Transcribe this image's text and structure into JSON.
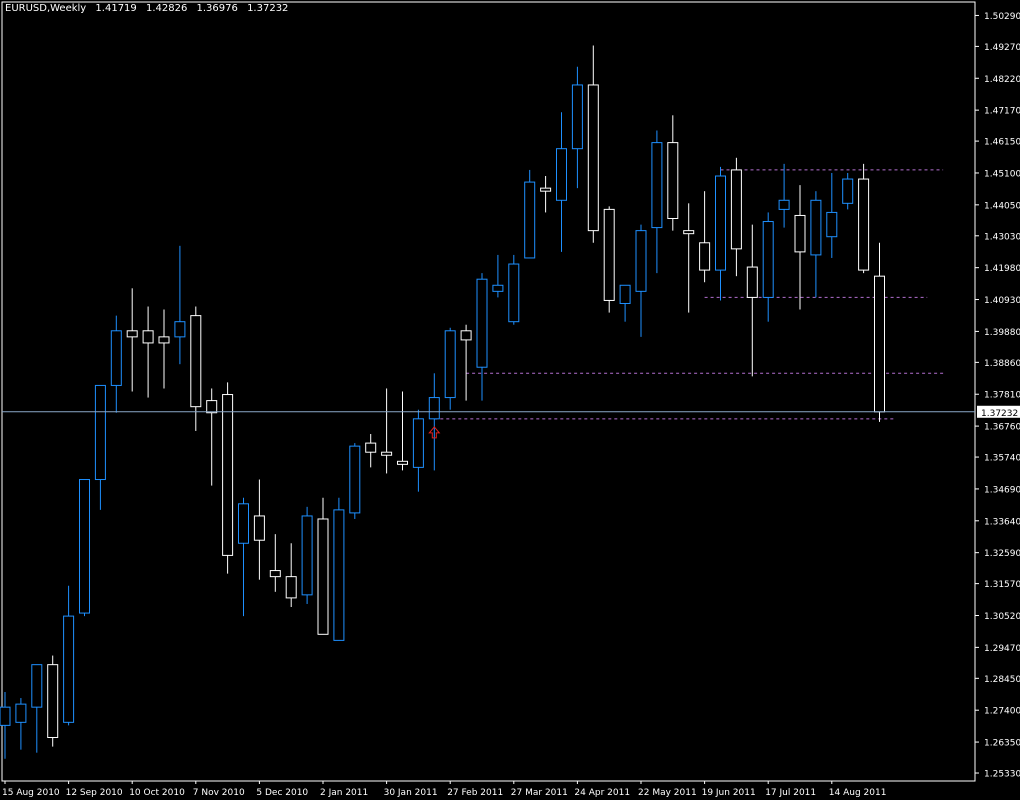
{
  "header": {
    "symbol": "EURUSD,Weekly",
    "open": "1.41719",
    "high": "1.42826",
    "low": "1.36976",
    "close": "1.37232"
  },
  "colors": {
    "background": "#000000",
    "bull": "#1e90ff",
    "bear": "#ffffff",
    "wick_bull": "#1e90ff",
    "wick_bear": "#ffffff",
    "grid_axis": "#ffffff",
    "price_line": "#8aa8c8",
    "level_line": "#b36fcf",
    "arrow": "#e02020"
  },
  "chart_data": {
    "type": "candlestick",
    "price_axis": {
      "ylim": [
        1.251,
        1.507
      ],
      "ticks": [
        "1.50290",
        "1.49270",
        "1.48220",
        "1.47170",
        "1.46150",
        "1.45100",
        "1.44050",
        "1.43030",
        "1.41980",
        "1.40930",
        "1.39880",
        "1.38860",
        "1.37810",
        "1.36760",
        "1.35740",
        "1.34690",
        "1.33640",
        "1.32590",
        "1.31570",
        "1.30520",
        "1.29470",
        "1.28450",
        "1.27400",
        "1.26350",
        "1.25330"
      ]
    },
    "time_axis": {
      "labels": [
        {
          "text": "15 Aug 2010",
          "index": 0
        },
        {
          "text": "12 Sep 2010",
          "index": 4
        },
        {
          "text": "10 Oct 2010",
          "index": 8
        },
        {
          "text": "7 Nov 2010",
          "index": 12
        },
        {
          "text": "5 Dec 2010",
          "index": 16
        },
        {
          "text": "2 Jan 2011",
          "index": 20
        },
        {
          "text": "30 Jan 2011",
          "index": 24
        },
        {
          "text": "27 Feb 2011",
          "index": 28
        },
        {
          "text": "27 Mar 2011",
          "index": 32
        },
        {
          "text": "24 Apr 2011",
          "index": 36
        },
        {
          "text": "22 May 2011",
          "index": 40
        },
        {
          "text": "19 Jun 2011",
          "index": 44
        },
        {
          "text": "17 Jul 2011",
          "index": 48
        },
        {
          "text": "14 Aug 2011",
          "index": 52
        }
      ]
    },
    "current_price": "1.37232",
    "candles": [
      {
        "o": 1.269,
        "h": 1.28,
        "l": 1.258,
        "c": 1.275
      },
      {
        "o": 1.27,
        "h": 1.278,
        "l": 1.261,
        "c": 1.276
      },
      {
        "o": 1.275,
        "h": 1.289,
        "l": 1.26,
        "c": 1.289
      },
      {
        "o": 1.289,
        "h": 1.292,
        "l": 1.262,
        "c": 1.265
      },
      {
        "o": 1.27,
        "h": 1.315,
        "l": 1.269,
        "c": 1.305
      },
      {
        "o": 1.306,
        "h": 1.319,
        "l": 1.305,
        "c": 1.35
      },
      {
        "o": 1.35,
        "h": 1.379,
        "l": 1.34,
        "c": 1.381
      },
      {
        "o": 1.381,
        "h": 1.404,
        "l": 1.372,
        "c": 1.399
      },
      {
        "o": 1.399,
        "h": 1.413,
        "l": 1.379,
        "c": 1.397
      },
      {
        "o": 1.399,
        "h": 1.407,
        "l": 1.377,
        "c": 1.395
      },
      {
        "o": 1.397,
        "h": 1.406,
        "l": 1.38,
        "c": 1.395
      },
      {
        "o": 1.397,
        "h": 1.427,
        "l": 1.388,
        "c": 1.402
      },
      {
        "o": 1.404,
        "h": 1.407,
        "l": 1.366,
        "c": 1.374
      },
      {
        "o": 1.376,
        "h": 1.38,
        "l": 1.348,
        "c": 1.372
      },
      {
        "o": 1.378,
        "h": 1.382,
        "l": 1.319,
        "c": 1.325
      },
      {
        "o": 1.329,
        "h": 1.344,
        "l": 1.305,
        "c": 1.342
      },
      {
        "o": 1.338,
        "h": 1.35,
        "l": 1.317,
        "c": 1.33
      },
      {
        "o": 1.32,
        "h": 1.332,
        "l": 1.313,
        "c": 1.318
      },
      {
        "o": 1.318,
        "h": 1.329,
        "l": 1.308,
        "c": 1.311
      },
      {
        "o": 1.312,
        "h": 1.341,
        "l": 1.309,
        "c": 1.338
      },
      {
        "o": 1.337,
        "h": 1.344,
        "l": 1.299,
        "c": 1.299
      },
      {
        "o": 1.297,
        "h": 1.344,
        "l": 1.297,
        "c": 1.34
      },
      {
        "o": 1.339,
        "h": 1.362,
        "l": 1.337,
        "c": 1.361
      },
      {
        "o": 1.362,
        "h": 1.365,
        "l": 1.354,
        "c": 1.359
      },
      {
        "o": 1.359,
        "h": 1.38,
        "l": 1.352,
        "c": 1.358
      },
      {
        "o": 1.356,
        "h": 1.379,
        "l": 1.353,
        "c": 1.355
      },
      {
        "o": 1.354,
        "h": 1.373,
        "l": 1.346,
        "c": 1.37
      },
      {
        "o": 1.37,
        "h": 1.385,
        "l": 1.353,
        "c": 1.377
      },
      {
        "o": 1.377,
        "h": 1.4,
        "l": 1.373,
        "c": 1.399
      },
      {
        "o": 1.399,
        "h": 1.401,
        "l": 1.376,
        "c": 1.396
      },
      {
        "o": 1.387,
        "h": 1.418,
        "l": 1.376,
        "c": 1.416
      },
      {
        "o": 1.412,
        "h": 1.424,
        "l": 1.41,
        "c": 1.414
      },
      {
        "o": 1.402,
        "h": 1.424,
        "l": 1.401,
        "c": 1.421
      },
      {
        "o": 1.423,
        "h": 1.452,
        "l": 1.423,
        "c": 1.448
      },
      {
        "o": 1.446,
        "h": 1.45,
        "l": 1.438,
        "c": 1.445
      },
      {
        "o": 1.442,
        "h": 1.471,
        "l": 1.425,
        "c": 1.459
      },
      {
        "o": 1.459,
        "h": 1.486,
        "l": 1.446,
        "c": 1.48
      },
      {
        "o": 1.48,
        "h": 1.493,
        "l": 1.428,
        "c": 1.432
      },
      {
        "o": 1.439,
        "h": 1.44,
        "l": 1.405,
        "c": 1.409
      },
      {
        "o": 1.408,
        "h": 1.414,
        "l": 1.402,
        "c": 1.414
      },
      {
        "o": 1.412,
        "h": 1.434,
        "l": 1.397,
        "c": 1.432
      },
      {
        "o": 1.433,
        "h": 1.465,
        "l": 1.418,
        "c": 1.461
      },
      {
        "o": 1.461,
        "h": 1.47,
        "l": 1.432,
        "c": 1.436
      },
      {
        "o": 1.432,
        "h": 1.441,
        "l": 1.405,
        "c": 1.431
      },
      {
        "o": 1.428,
        "h": 1.445,
        "l": 1.415,
        "c": 1.419
      },
      {
        "o": 1.419,
        "h": 1.453,
        "l": 1.409,
        "c": 1.45
      },
      {
        "o": 1.452,
        "h": 1.456,
        "l": 1.417,
        "c": 1.426
      },
      {
        "o": 1.42,
        "h": 1.434,
        "l": 1.384,
        "c": 1.41
      },
      {
        "o": 1.41,
        "h": 1.438,
        "l": 1.402,
        "c": 1.435
      },
      {
        "o": 1.439,
        "h": 1.454,
        "l": 1.433,
        "c": 1.442
      },
      {
        "o": 1.437,
        "h": 1.447,
        "l": 1.406,
        "c": 1.425
      },
      {
        "o": 1.424,
        "h": 1.445,
        "l": 1.41,
        "c": 1.442
      },
      {
        "o": 1.43,
        "h": 1.451,
        "l": 1.423,
        "c": 1.438
      },
      {
        "o": 1.441,
        "h": 1.451,
        "l": 1.439,
        "c": 1.449
      },
      {
        "o": 1.449,
        "h": 1.454,
        "l": 1.418,
        "c": 1.419
      },
      {
        "o": 1.417,
        "h": 1.428,
        "l": 1.369,
        "c": 1.3723
      }
    ],
    "levels": [
      {
        "price": 1.452,
        "from_index": 45,
        "to_index": 59
      },
      {
        "price": 1.41,
        "from_index": 44,
        "to_index": 58
      },
      {
        "price": 1.385,
        "from_index": 29,
        "to_index": 59
      },
      {
        "price": 1.37,
        "from_index": 27,
        "to_index": 56
      }
    ],
    "marker": {
      "type": "up-arrow",
      "index": 27,
      "price": 1.368
    }
  }
}
